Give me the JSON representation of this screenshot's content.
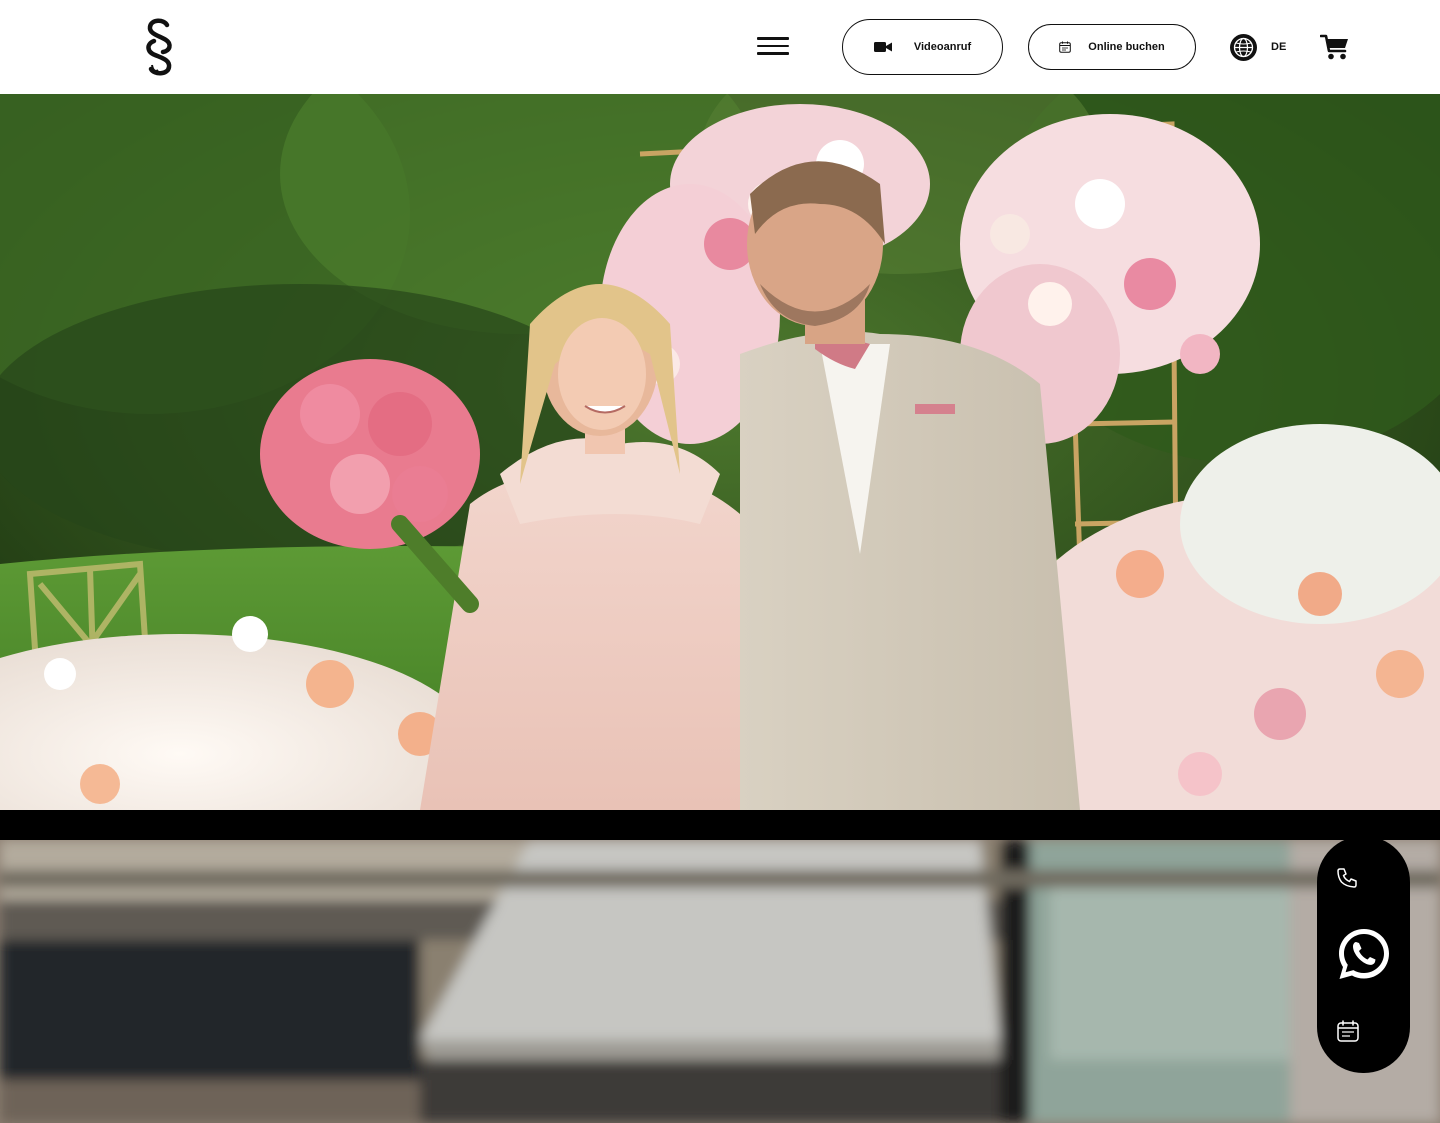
{
  "header": {
    "logo_icon": "section-sign-logo",
    "menu_icon": "hamburger-menu-icon",
    "video_button": {
      "label": "Videoanruf",
      "icon": "video-camera-icon"
    },
    "book_button": {
      "label": "Online buchen",
      "icon": "calendar-icon"
    },
    "language": {
      "label": "DE",
      "icon": "globe-icon"
    },
    "cart_icon": "shopping-cart-icon"
  },
  "hero": {
    "image": "wedding-couple-flower-arch-photo"
  },
  "second_section": {
    "image": "blurred-storefront-awning-photo"
  },
  "contact_bar": {
    "items": [
      {
        "icon": "phone-icon"
      },
      {
        "icon": "whatsapp-icon"
      },
      {
        "icon": "calendar-icon"
      }
    ]
  },
  "colors": {
    "text": "#111111",
    "background": "#ffffff",
    "contact_bar": "#000000"
  }
}
